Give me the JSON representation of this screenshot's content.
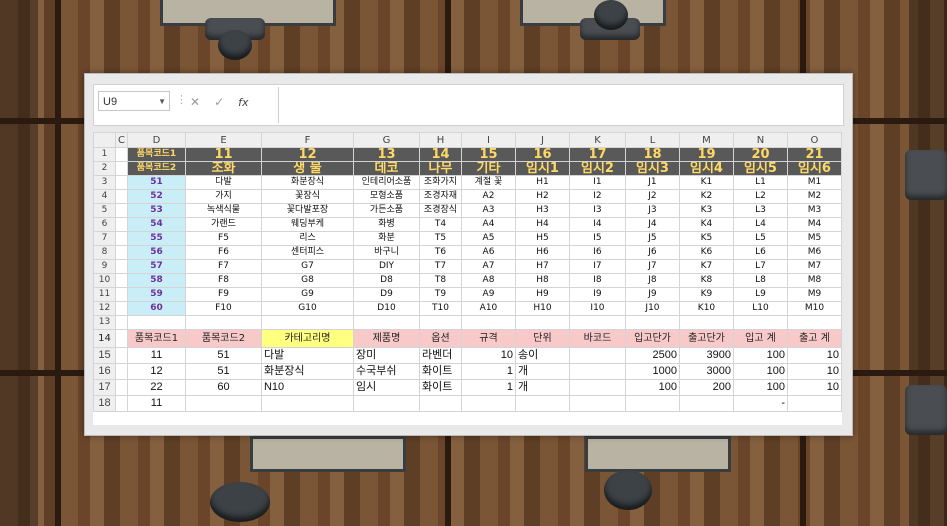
{
  "formula_bar": {
    "name_box": "U9",
    "cancel_icon": "✕",
    "enter_icon": "✓",
    "fx_label": "fx",
    "formula": ""
  },
  "sheet": {
    "columns": [
      "C",
      "D",
      "E",
      "F",
      "G",
      "H",
      "I",
      "J",
      "K",
      "L",
      "M",
      "N",
      "O"
    ],
    "row_numbers": [
      "1",
      "2",
      "3",
      "4",
      "5",
      "6",
      "7",
      "8",
      "9",
      "10",
      "11",
      "12",
      "13",
      "14",
      "15",
      "16",
      "17",
      "18"
    ],
    "row1": [
      "품목코드1",
      "11",
      "12",
      "13",
      "14",
      "15",
      "16",
      "17",
      "18",
      "19",
      "20",
      "21"
    ],
    "row2": [
      "품목코드2",
      "조화",
      "생 물",
      "데코",
      "나무",
      "기타",
      "임시1",
      "임시2",
      "임시3",
      "임시4",
      "임시5",
      "임시6"
    ],
    "grid": [
      [
        "51",
        "다발",
        "화분장식",
        "인테리어소품",
        "조화가지",
        "계절 꽃",
        "H1",
        "I1",
        "J1",
        "K1",
        "L1",
        "M1"
      ],
      [
        "52",
        "가지",
        "꽃장식",
        "모형소품",
        "조경자재",
        "A2",
        "H2",
        "I2",
        "J2",
        "K2",
        "L2",
        "M2"
      ],
      [
        "53",
        "녹색식물",
        "꽃다발포장",
        "가든소품",
        "조경장식",
        "A3",
        "H3",
        "I3",
        "J3",
        "K3",
        "L3",
        "M3"
      ],
      [
        "54",
        "가랜드",
        "웨딩부케",
        "화병",
        "T4",
        "A4",
        "H4",
        "I4",
        "J4",
        "K4",
        "L4",
        "M4"
      ],
      [
        "55",
        "F5",
        "리스",
        "화분",
        "T5",
        "A5",
        "H5",
        "I5",
        "J5",
        "K5",
        "L5",
        "M5"
      ],
      [
        "56",
        "F6",
        "센터피스",
        "바구니",
        "T6",
        "A6",
        "H6",
        "I6",
        "J6",
        "K6",
        "L6",
        "M6"
      ],
      [
        "57",
        "F7",
        "G7",
        "DIY",
        "T7",
        "A7",
        "H7",
        "I7",
        "J7",
        "K7",
        "L7",
        "M7"
      ],
      [
        "58",
        "F8",
        "G8",
        "D8",
        "T8",
        "A8",
        "H8",
        "I8",
        "J8",
        "K8",
        "L8",
        "M8"
      ],
      [
        "59",
        "F9",
        "G9",
        "D9",
        "T9",
        "A9",
        "H9",
        "I9",
        "J9",
        "K9",
        "L9",
        "M9"
      ],
      [
        "60",
        "F10",
        "G10",
        "D10",
        "T10",
        "A10",
        "H10",
        "I10",
        "J10",
        "K10",
        "L10",
        "M10"
      ]
    ],
    "headers2": [
      "품목코드1",
      "품목코드2",
      "카테고리명",
      "제품명",
      "옵션",
      "규격",
      "단위",
      "바코드",
      "입고단가",
      "출고단가",
      "입고 계",
      "출고 계"
    ],
    "data_rows": [
      [
        "11",
        "51",
        "다발",
        "장미",
        "라벤더",
        "10",
        "송이",
        "",
        "2500",
        "3900",
        "100",
        "10"
      ],
      [
        "12",
        "51",
        "화분장식",
        "수국부쉬",
        "화이트",
        "1",
        "개",
        "",
        "1000",
        "3000",
        "100",
        "10"
      ],
      [
        "22",
        "60",
        "N10",
        "임시",
        "화이트",
        "1",
        "개",
        "",
        "100",
        "200",
        "100",
        "10"
      ],
      [
        "11",
        "",
        "",
        "",
        "",
        "",
        "",
        "",
        "",
        "",
        "-",
        ""
      ]
    ]
  }
}
